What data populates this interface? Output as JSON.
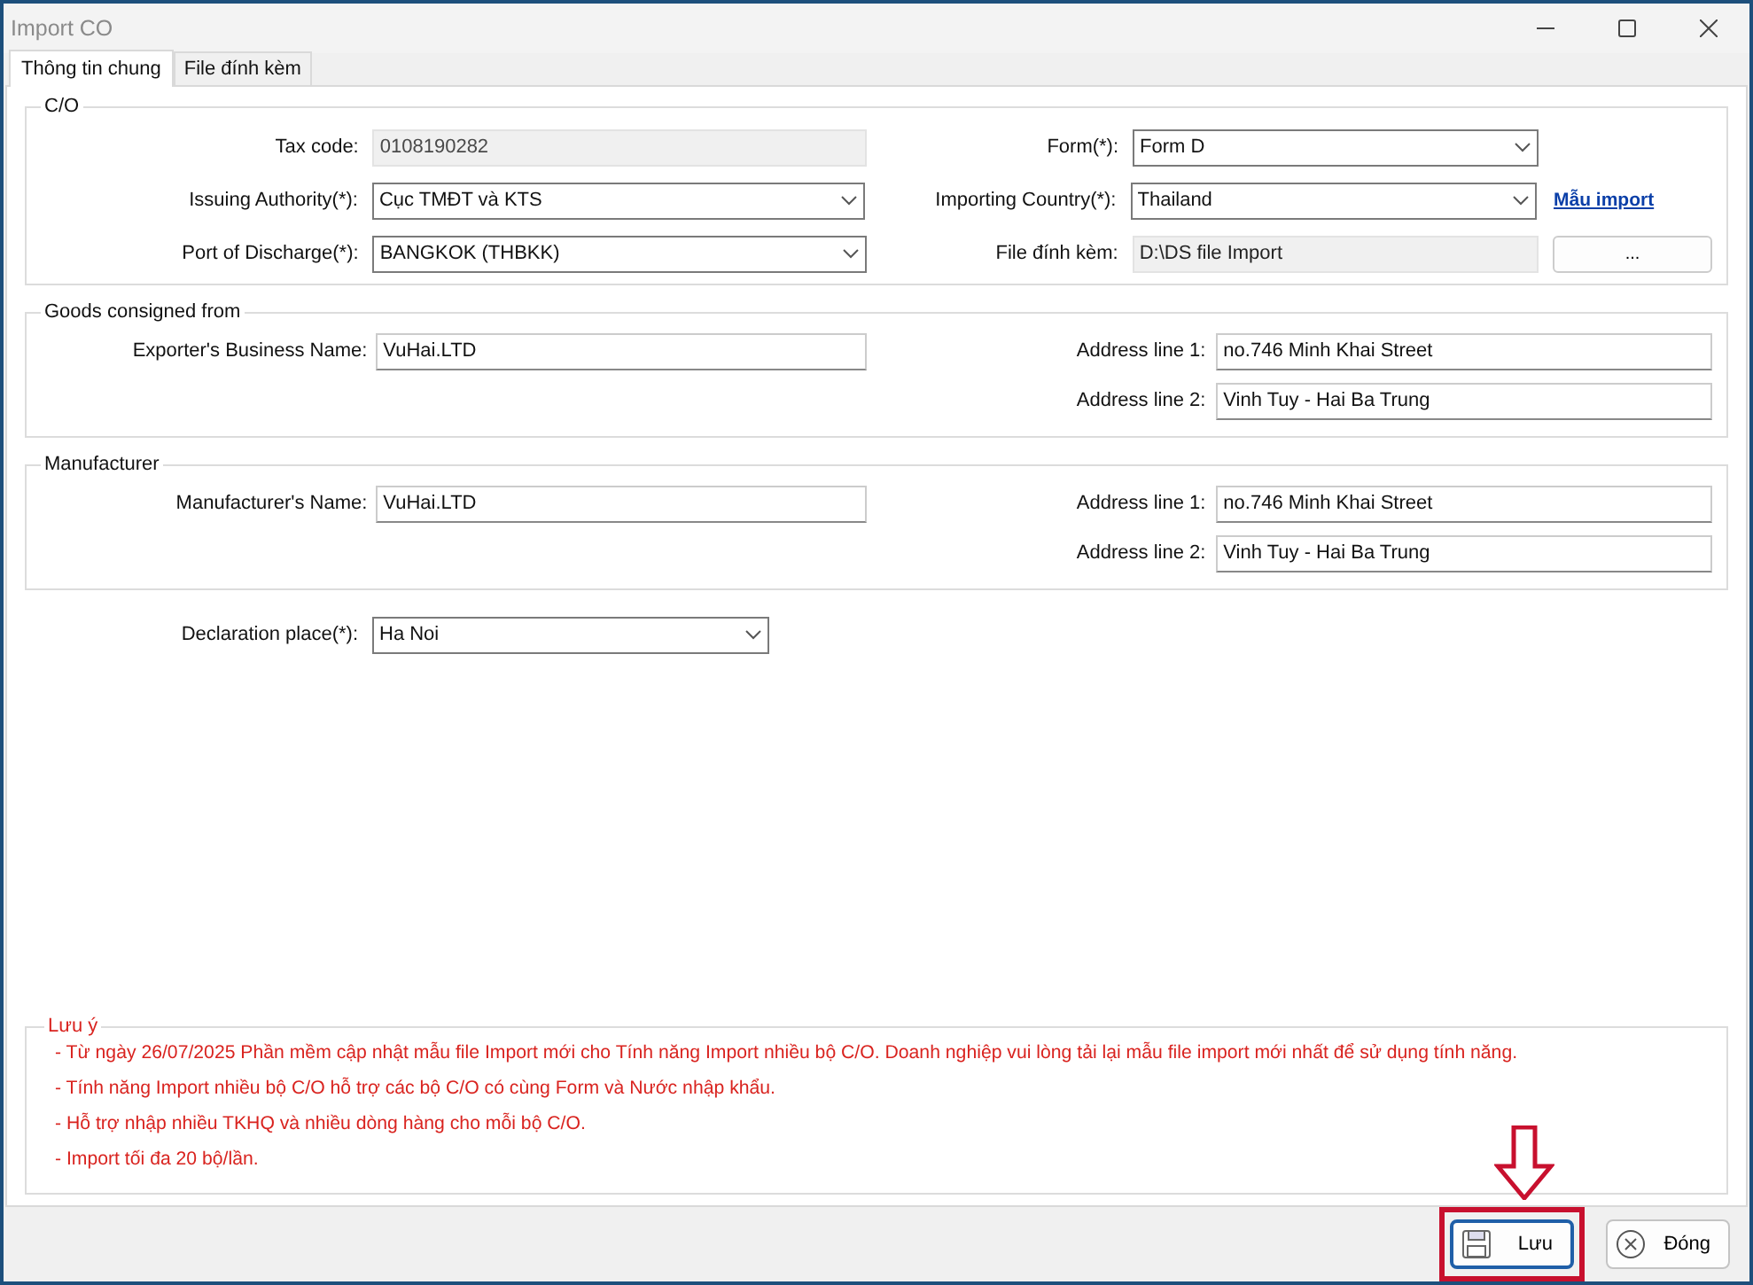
{
  "window": {
    "title": "Import CO"
  },
  "tabs": [
    {
      "label": "Thông tin chung",
      "selected": true
    },
    {
      "label": "File đính kèm",
      "selected": false
    }
  ],
  "co_section": {
    "title": "C/O",
    "left_fields": [
      {
        "label": "Tax code:",
        "value": "0108190282",
        "kind": "readonly"
      },
      {
        "label": "Issuing Authority(*):",
        "value": "Cục TMĐT và KTS",
        "kind": "dropdown"
      },
      {
        "label": "Port of Discharge(*):",
        "value": "BANGKOK (THBKK)",
        "kind": "dropdown"
      }
    ],
    "right_fields": [
      {
        "label": "Form(*):",
        "value": "Form D",
        "kind": "dropdown"
      },
      {
        "label": "Importing Country(*):",
        "value": "Thailand",
        "kind": "dropdown"
      },
      {
        "label": "File đính kèm:",
        "value": "D:\\DS file Import",
        "kind": "readonly"
      }
    ],
    "template_link": "Mẫu import",
    "browse_button": "..."
  },
  "parties": [
    {
      "title": "Goods consigned from",
      "name_label": "Exporter's Business Name:",
      "name_value": "VuHai.LTD",
      "address": [
        {
          "label": "Address line 1:",
          "value": "no.746 Minh Khai Street"
        },
        {
          "label": "Address line 2:",
          "value": "Vinh Tuy - Hai Ba Trung"
        }
      ]
    },
    {
      "title": "Manufacturer",
      "name_label": "Manufacturer's Name:",
      "name_value": "VuHai.LTD",
      "address": [
        {
          "label": "Address line 1:",
          "value": "no.746 Minh Khai Street"
        },
        {
          "label": "Address line 2:",
          "value": "Vinh Tuy - Hai Ba Trung"
        }
      ]
    }
  ],
  "declaration_place": {
    "label": "Declaration place(*):",
    "value": "Ha Noi"
  },
  "note": {
    "title": "Lưu ý",
    "lines": [
      "- Từ ngày 26/07/2025 Phần mềm cập nhật mẫu file Import mới cho Tính năng Import nhiều bộ C/O. Doanh nghiệp vui lòng tải lại mẫu file import mới nhất để sử dụng tính năng.",
      "- Tính năng Import nhiều bộ C/O hỗ trợ các bộ C/O có cùng Form và Nước nhập khẩu.",
      "- Hỗ trợ nhập nhiều TKHQ và nhiều dòng hàng cho mỗi bộ C/O.",
      "- Import tối đa 20 bộ/lần."
    ]
  },
  "buttons": [
    {
      "label": "Lưu",
      "kind": "save",
      "highlighted": true
    },
    {
      "label": "Đóng",
      "kind": "close",
      "highlighted": false
    }
  ]
}
